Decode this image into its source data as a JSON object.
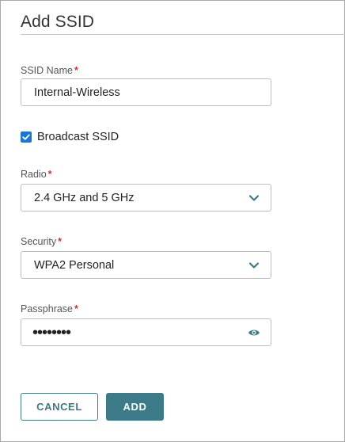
{
  "dialog": {
    "title": "Add SSID"
  },
  "fields": {
    "ssid_name": {
      "label": "SSID Name",
      "required_mark": "*",
      "value": "Internal-Wireless"
    },
    "broadcast_ssid": {
      "label": "Broadcast SSID",
      "checked": true
    },
    "radio": {
      "label": "Radio",
      "required_mark": "*",
      "value": "2.4 GHz and 5 GHz",
      "icon": "chevron-down-icon"
    },
    "security": {
      "label": "Security",
      "required_mark": "*",
      "value": "WPA2 Personal",
      "icon": "chevron-down-icon"
    },
    "passphrase": {
      "label": "Passphrase",
      "required_mark": "*",
      "masked_value": "••••••••",
      "icon": "eye-icon"
    }
  },
  "buttons": {
    "cancel_label": "CANCEL",
    "add_label": "ADD"
  },
  "colors": {
    "accent": "#3b7a86",
    "checkbox": "#1976d2",
    "required": "#d32f2f"
  }
}
